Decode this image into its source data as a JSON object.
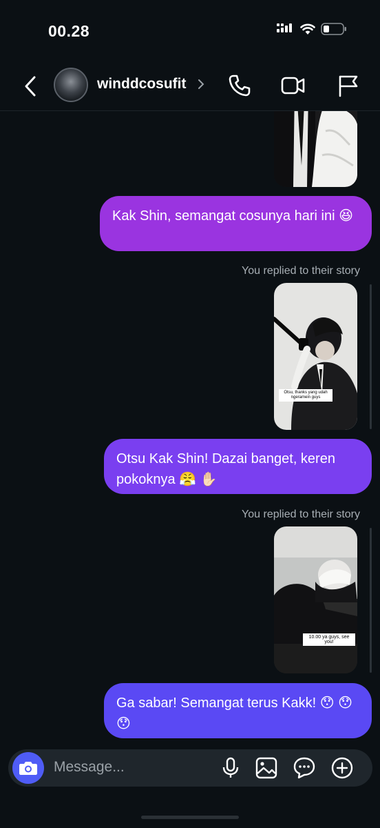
{
  "status_bar": {
    "time": "00.28",
    "icons": [
      "signal-icon",
      "wifi-icon",
      "battery-icon"
    ]
  },
  "header": {
    "username": "winddcosufit",
    "icons": [
      "back-icon",
      "chevron-right-icon",
      "phone-icon",
      "video-icon",
      "flag-icon"
    ]
  },
  "messages": [
    {
      "type": "story_image",
      "caption": ""
    },
    {
      "type": "bubble",
      "text": "Kak Shin, semangat cosunya hari ini 😆",
      "color": "#9a34e0"
    },
    {
      "type": "reply_label",
      "text": "You replied to their story"
    },
    {
      "type": "story_image",
      "caption": "Otsu, thanks yang udah ngeramein guys"
    },
    {
      "type": "bubble",
      "text": "Otsu Kak Shin! Dazai banget, keren pokoknya 😤 ✋🏻",
      "color": "#7a3ff0"
    },
    {
      "type": "reply_label",
      "text": "You replied to their story"
    },
    {
      "type": "story_image",
      "caption": "10.00 ya guys, see you!"
    },
    {
      "type": "bubble",
      "text": "Ga sabar! Semangat terus Kakk! 😯 😯 😯",
      "color": "#5a49f4"
    }
  ],
  "composer": {
    "placeholder": "Message...",
    "icons": [
      "camera-icon",
      "microphone-icon",
      "gallery-icon",
      "sticker-icon",
      "add-icon"
    ]
  },
  "colors": {
    "background": "#0b1014",
    "bubble_top": "#9a34e0",
    "bubble_mid": "#7a3ff0",
    "bubble_bottom": "#5a49f4",
    "camera_button": "#4f5cf6"
  }
}
